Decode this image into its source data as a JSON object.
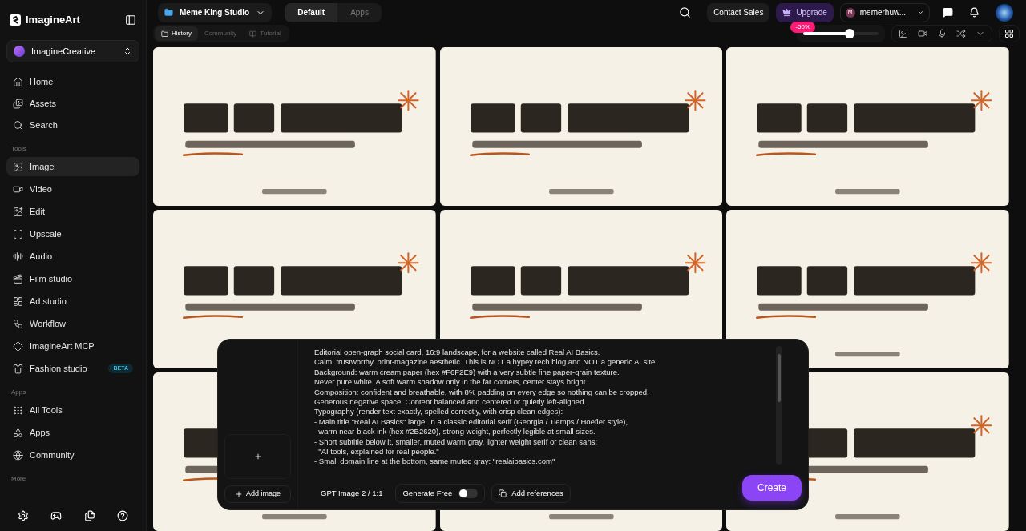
{
  "sidebar": {
    "brand": "ImagineArt",
    "workspace": "ImagineCreative",
    "nav": [
      {
        "label": "Home",
        "selected": false
      },
      {
        "label": "Assets",
        "selected": false
      },
      {
        "label": "Search",
        "selected": false
      }
    ],
    "sections": [
      {
        "title": "Tools",
        "items": [
          {
            "label": "Image",
            "selected": true
          },
          {
            "label": "Video",
            "selected": false
          },
          {
            "label": "Edit",
            "selected": false
          },
          {
            "label": "Upscale",
            "selected": false
          },
          {
            "label": "Audio",
            "selected": false
          },
          {
            "label": "Film studio",
            "selected": false
          },
          {
            "label": "Ad studio",
            "selected": false
          },
          {
            "label": "Workflow",
            "selected": false
          },
          {
            "label": "ImagineArt MCP",
            "selected": false
          },
          {
            "label": "Fashion studio",
            "selected": false,
            "badge": "BETA"
          }
        ]
      },
      {
        "title": "Apps",
        "items": [
          {
            "label": "All Tools",
            "selected": false
          },
          {
            "label": "Apps",
            "selected": false
          },
          {
            "label": "Community",
            "selected": false
          }
        ]
      },
      {
        "title": "More"
      }
    ]
  },
  "header": {
    "project": "Meme King Studio",
    "mode_tabs": [
      {
        "label": "Default",
        "selected": true
      },
      {
        "label": "Apps",
        "selected": false
      }
    ],
    "view_tabs": [
      {
        "label": "History",
        "selected": true
      },
      {
        "label": "Community",
        "selected": false
      },
      {
        "label": "Tutorial",
        "selected": false
      }
    ],
    "contact": "Contact Sales",
    "upgrade": "Upgrade",
    "discount": "-50%",
    "user": {
      "initial": "M",
      "name": "memerhuw..."
    },
    "zoom": {
      "level": 0.62
    }
  },
  "prompt": {
    "text": "Editorial open-graph social card, 16:9 landscape, for a website called Real AI Basics.\nCalm, trustworthy, print-magazine aesthetic. This is NOT a hypey tech blog and NOT a generic AI site.\nBackground: warm cream paper (hex #F6F2E9) with a very subtle fine paper-grain texture.\nNever pure white. A soft warm shadow only in the far corners, center stays bright.\nComposition: confident and breathable, with 8% padding on every edge so nothing can be cropped.\nGenerous negative space. Content balanced and centered or quietly left-aligned.\nTypography (render text exactly, spelled correctly, with crisp clean edges):\n- Main title \"Real AI Basics\" large, in a classic editorial serif (Georgia / Tiemps / Hoefler style),\n  warm near-black ink (hex #2B2620), strong weight, perfectly legible at small sizes.\n- Short subtitle below it, smaller, muted warm gray, lighter weight serif or clean sans:\n  \"AI tools, explained for real people.\"\n- Small domain line at the bottom, same muted gray: \"realaibasics.com\"",
    "add_image": "Add image",
    "model": "GPT Image 2 / 1:1",
    "generate_free": {
      "label": "Generate Free",
      "on": false
    },
    "add_references": "Add references",
    "create": "Create"
  }
}
